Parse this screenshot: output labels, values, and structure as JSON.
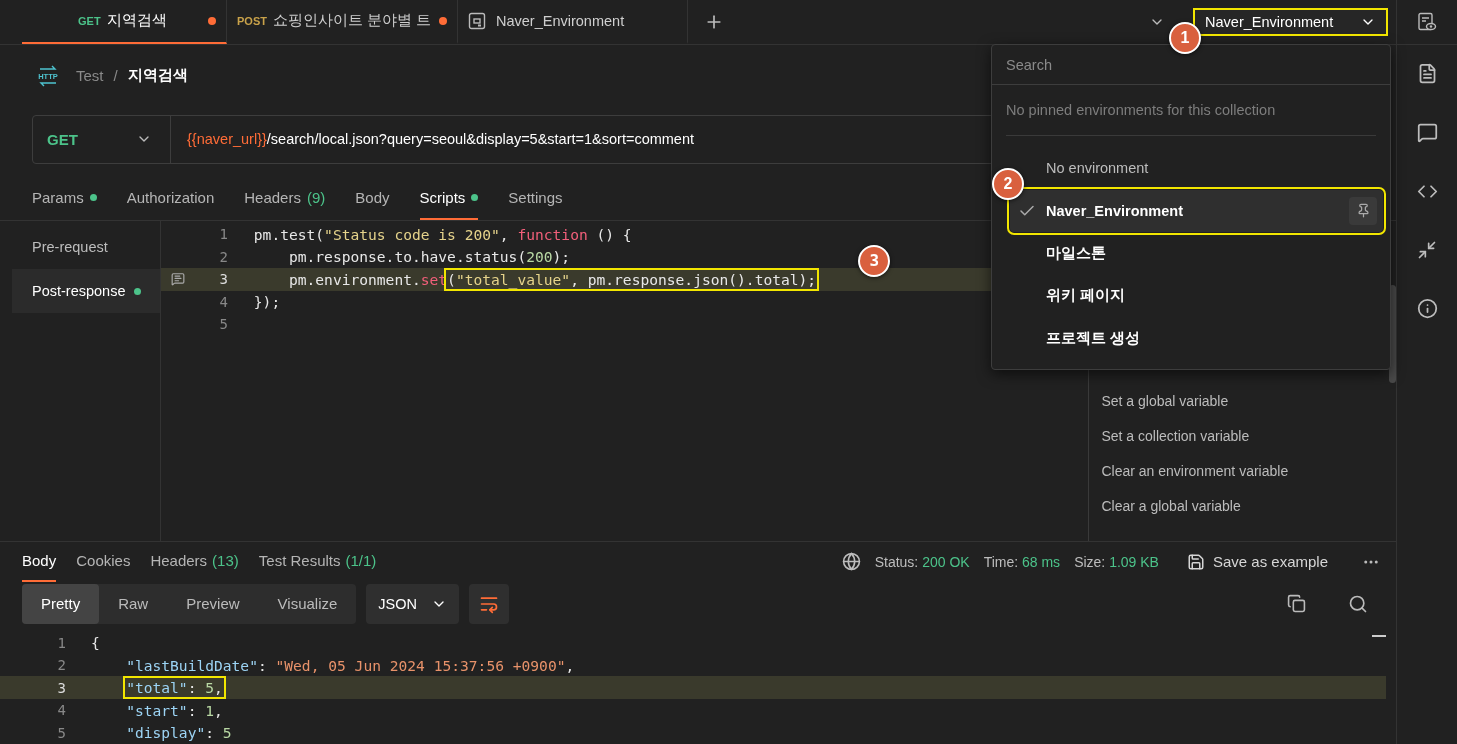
{
  "top_tabs": [
    {
      "kind": "request",
      "method": "GET",
      "label": "지역검색",
      "selected": true,
      "unsaved": true
    },
    {
      "kind": "request",
      "method": "POST",
      "label": "쇼핑인사이트 분야별 트",
      "selected": false,
      "unsaved": true
    },
    {
      "kind": "environment",
      "label": "Naver_Environment",
      "selected": false,
      "unsaved": false
    }
  ],
  "environment_selector": {
    "value": "Naver_Environment",
    "highlighted": true,
    "badge": "1"
  },
  "breadcrumb": {
    "icon_text": "HTTP",
    "collection": "Test",
    "separator": "/",
    "request": "지역검색"
  },
  "request_bar": {
    "method": "GET",
    "url_variable": "{{naver_url}}",
    "url_path": "/search/local.json?query=seoul&display=5&start=1&sort=comment"
  },
  "request_tabs": [
    {
      "label": "Params",
      "dot": true,
      "selected": false
    },
    {
      "label": "Authorization",
      "dot": false,
      "selected": false
    },
    {
      "label": "Headers",
      "count": "(9)",
      "dot": false,
      "selected": false
    },
    {
      "label": "Body",
      "dot": false,
      "selected": false
    },
    {
      "label": "Scripts",
      "dot": true,
      "selected": true
    },
    {
      "label": "Settings",
      "dot": false,
      "selected": false
    }
  ],
  "script_tabs": [
    {
      "label": "Pre-request",
      "dot": false,
      "selected": false
    },
    {
      "label": "Post-response",
      "dot": true,
      "selected": true
    }
  ],
  "script_lines": [
    {
      "number": "1",
      "highlighted": false,
      "indented": false,
      "comment_marker": false,
      "tokens": [
        {
          "kind": "plain",
          "text": "pm.test("
        },
        {
          "kind": "string",
          "text": "\"Status code is 200\""
        },
        {
          "kind": "plain",
          "text": ", "
        },
        {
          "kind": "keyword",
          "text": "function"
        },
        {
          "kind": "plain",
          "text": " () {"
        }
      ]
    },
    {
      "number": "2",
      "highlighted": false,
      "indented": true,
      "comment_marker": false,
      "tokens": [
        {
          "kind": "plain",
          "text": "pm.response.to.have.status("
        },
        {
          "kind": "number",
          "text": "200"
        },
        {
          "kind": "plain",
          "text": ");"
        }
      ]
    },
    {
      "number": "3",
      "highlighted": true,
      "indented": true,
      "comment_marker": true,
      "badge": "3",
      "tokens": [
        {
          "kind": "plain",
          "text": "pm.environment."
        },
        {
          "kind": "keyword",
          "text": "set"
        },
        {
          "kind": "plain",
          "text": "(",
          "annotated": true
        },
        {
          "kind": "string",
          "text": "\"total_value\"",
          "annotated": true
        },
        {
          "kind": "plain",
          "text": ", pm.response.json().total);",
          "annotated": true
        }
      ]
    },
    {
      "number": "4",
      "highlighted": false,
      "indented": false,
      "comment_marker": false,
      "tokens": [
        {
          "kind": "plain",
          "text": "});"
        }
      ]
    },
    {
      "number": "5",
      "highlighted": false,
      "comment_marker": false
    }
  ],
  "snippets": [
    "Set a global variable",
    "Set a collection variable",
    "Clear an environment variable",
    "Clear a global variable"
  ],
  "environment_menu": {
    "search_placeholder": "Search",
    "pinned_note": "No pinned environments for this collection",
    "items": [
      {
        "kind": "none",
        "label": "No environment",
        "selected": false
      },
      {
        "kind": "environment",
        "label": "Naver_Environment",
        "selected": true,
        "highlighted": true,
        "badge": "2"
      },
      {
        "kind": "environment",
        "label": "마일스톤",
        "selected": false
      },
      {
        "kind": "environment",
        "label": "위키 페이지",
        "selected": false
      },
      {
        "kind": "environment",
        "label": "프로젝트 생성",
        "selected": false
      }
    ]
  },
  "response_tabs": [
    {
      "label": "Body",
      "selected": true
    },
    {
      "label": "Cookies",
      "selected": false
    },
    {
      "label": "Headers",
      "count": "(13)",
      "selected": false
    },
    {
      "label": "Test Results",
      "count": "(1/1)",
      "selected": false
    }
  ],
  "response_meta": [
    {
      "label": "Status:",
      "value": "200 OK"
    },
    {
      "label": "Time:",
      "value": "68 ms"
    },
    {
      "label": "Size:",
      "value": "1.09 KB"
    }
  ],
  "save_example": "Save as example",
  "view_modes": [
    {
      "label": "Pretty",
      "selected": true
    },
    {
      "label": "Raw",
      "selected": false
    },
    {
      "label": "Preview",
      "selected": false
    },
    {
      "label": "Visualize",
      "selected": false
    }
  ],
  "format": "JSON",
  "response_lines": [
    {
      "number": "1",
      "highlighted": false,
      "indented": false,
      "tokens": [
        {
          "kind": "plain",
          "text": "{"
        }
      ]
    },
    {
      "number": "2",
      "highlighted": false,
      "indented": true,
      "tokens": [
        {
          "kind": "key",
          "text": "\"lastBuildDate\""
        },
        {
          "kind": "plain",
          "text": ": "
        },
        {
          "kind": "value",
          "text": "\"Wed, 05 Jun 2024 15:37:56 +0900\""
        },
        {
          "kind": "plain",
          "text": ","
        }
      ]
    },
    {
      "number": "3",
      "highlighted": true,
      "indented": true,
      "tokens": [
        {
          "kind": "key",
          "text": "\"total\"",
          "annotated": true
        },
        {
          "kind": "plain",
          "text": ": ",
          "annotated": true
        },
        {
          "kind": "number",
          "text": "5",
          "annotated": true
        },
        {
          "kind": "plain",
          "text": ",",
          "annotated": true
        }
      ]
    },
    {
      "number": "4",
      "highlighted": false,
      "indented": true,
      "tokens": [
        {
          "kind": "key",
          "text": "\"start\""
        },
        {
          "kind": "plain",
          "text": ": "
        },
        {
          "kind": "number",
          "text": "1"
        },
        {
          "kind": "plain",
          "text": ","
        }
      ]
    },
    {
      "number": "5",
      "highlighted": false,
      "indented": true,
      "tokens": [
        {
          "kind": "key",
          "text": "\"display\""
        },
        {
          "kind": "plain",
          "text": ": "
        },
        {
          "kind": "number",
          "text": "5"
        }
      ]
    }
  ]
}
